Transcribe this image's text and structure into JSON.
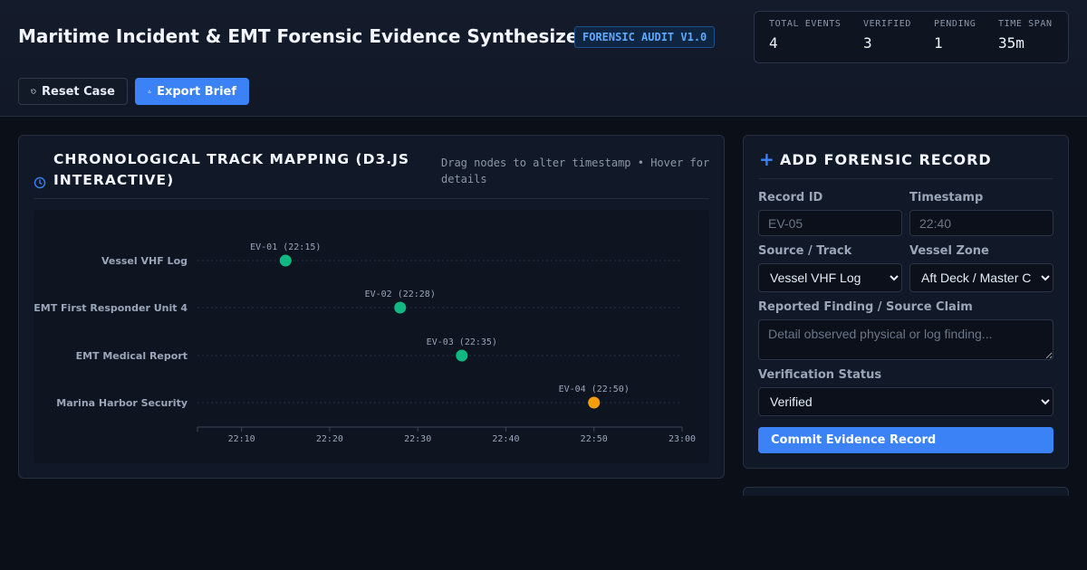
{
  "app": {
    "title": "Maritime Incident & EMT Forensic Evidence Synthesizer",
    "badge": "FORENSIC AUDIT V1.0"
  },
  "stats": [
    {
      "label": "TOTAL EVENTS",
      "value": "4"
    },
    {
      "label": "VERIFIED",
      "value": "3"
    },
    {
      "label": "PENDING",
      "value": "1"
    },
    {
      "label": "TIME SPAN",
      "value": "35m"
    }
  ],
  "toolbar": {
    "reset_label": "Reset Case",
    "export_label": "Export Brief",
    "reset_icon": "rotate-ccw-icon",
    "export_icon": "download-icon"
  },
  "timeline": {
    "title": "CHRONOLOGICAL TRACK MAPPING (D3.JS INTERACTIVE)",
    "hint": "Drag nodes to alter timestamp • Hover for details",
    "icon": "clock-icon"
  },
  "chart_data": {
    "type": "scatter",
    "x_axis": {
      "type": "time",
      "ticks": [
        "22:10",
        "22:20",
        "22:30",
        "22:40",
        "22:50",
        "23:00"
      ],
      "range": [
        "22:05",
        "23:00"
      ]
    },
    "tracks": [
      "Vessel VHF Log",
      "EMT First Responder Unit 4",
      "EMT Medical Report",
      "Marina Harbor Security"
    ],
    "events": [
      {
        "id": "EV-01",
        "time": "22:15",
        "track": "Vessel VHF Log",
        "status": "Verified",
        "label": "EV-01 (22:15)"
      },
      {
        "id": "EV-02",
        "time": "22:28",
        "track": "EMT First Responder Unit 4",
        "status": "Verified",
        "label": "EV-02 (22:28)"
      },
      {
        "id": "EV-03",
        "time": "22:35",
        "track": "EMT Medical Report",
        "status": "Verified",
        "label": "EV-03 (22:35)"
      },
      {
        "id": "EV-04",
        "time": "22:50",
        "track": "Marina Harbor Security",
        "status": "Pending",
        "label": "EV-04 (22:50)"
      }
    ],
    "status_colors": {
      "Verified": "#10b981",
      "Pending": "#f59e0b"
    },
    "grid": false
  },
  "form": {
    "title": "ADD FORENSIC RECORD",
    "icon": "plus-icon",
    "record_id_label": "Record ID",
    "record_id_placeholder": "EV-05",
    "timestamp_label": "Timestamp",
    "timestamp_placeholder": "22:40",
    "source_label": "Source / Track",
    "source_value": "Vessel VHF Log",
    "zone_label": "Vessel Zone",
    "zone_value": "Aft Deck / Master Cabin",
    "finding_label": "Reported Finding / Source Claim",
    "finding_placeholder": "Detail observed physical or log finding...",
    "status_label": "Verification Status",
    "status_value": "Verified",
    "commit_label": "Commit Evidence Record"
  },
  "colors": {
    "accent": "#3b82f6",
    "verified": "#10b981",
    "pending": "#f59e0b"
  }
}
